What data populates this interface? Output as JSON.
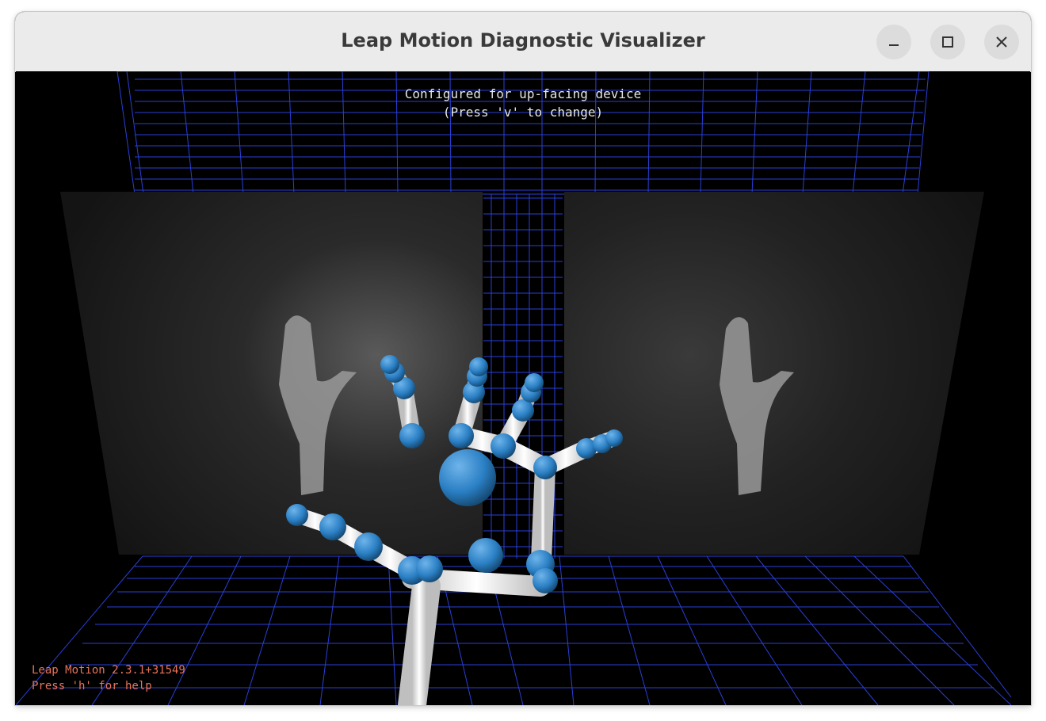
{
  "window": {
    "title": "Leap Motion Diagnostic Visualizer",
    "buttons": {
      "minimize": "minimize-icon",
      "maximize": "maximize-icon",
      "close": "close-icon"
    }
  },
  "hud": {
    "orientation_line1": "Configured for up-facing device",
    "orientation_line2": "(Press 'v' to change)",
    "version": "Leap Motion 2.3.1+31549",
    "help": "Press 'h' for help"
  },
  "colors": {
    "grid": "#2a3fd8",
    "joint": "#2a7fc4",
    "bone": "#f2f2f2",
    "hud_text": "#e6e6e6",
    "status_text": "#e8735a"
  }
}
